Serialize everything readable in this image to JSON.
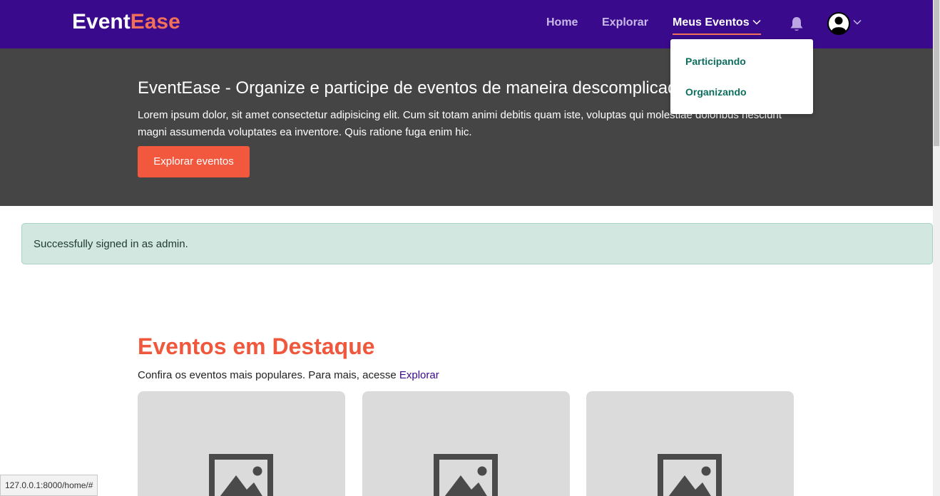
{
  "navbar": {
    "brand_main": "Event",
    "brand_accent": "Ease",
    "links": [
      "Home",
      "Explorar",
      "Meus Eventos"
    ],
    "icons": [
      "bell-icon",
      "user-avatar-icon",
      "chevron-down-icon"
    ],
    "bg_color": "#3a0a8c"
  },
  "dropdown": {
    "items": [
      "Participando",
      "Organizando"
    ]
  },
  "hero": {
    "title": "EventEase - Organize e participe de eventos de maneira descomplicada",
    "text": "Lorem ipsum dolor, sit amet consectetur adipisicing elit. Cum sit totam animi debitis quam iste, voluptas qui molestiae doloribus nesciunt magni assumenda voluptates ea inventore. Quis ratione fuga enim hic.",
    "button": "Explorar eventos"
  },
  "alert": {
    "text": "Successfully signed in as admin."
  },
  "featured": {
    "title": "Eventos em Destaque",
    "subtitle": "Confira os eventos mais populares. Para mais, acesse",
    "link": "Explorar"
  },
  "status_url": "127.0.0.1:8000/home/#"
}
